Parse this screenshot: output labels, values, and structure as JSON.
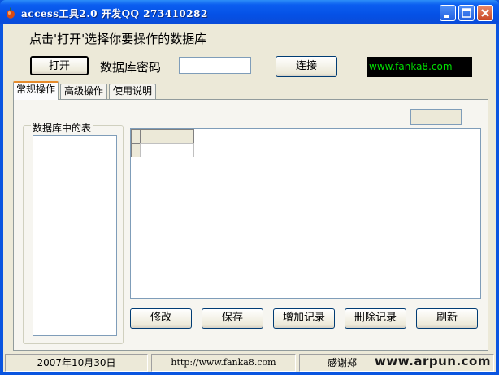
{
  "window": {
    "title": "access工具2.0 开发QQ 273410282"
  },
  "header": {
    "instruction": "点击'打开'选择你要操作的数据库",
    "open_button": "打开",
    "password_label": "数据库密码",
    "password_value": "",
    "connect_button": "连接",
    "site_badge": "www.fanka8.com"
  },
  "tabs": [
    {
      "label": "常规操作",
      "active": true
    },
    {
      "label": "高级操作",
      "active": false
    },
    {
      "label": "使用说明",
      "active": false
    }
  ],
  "tables_panel": {
    "title": "数据库中的表"
  },
  "actions": {
    "modify": "修改",
    "save": "保存",
    "add": "增加记录",
    "delete": "删除记录",
    "refresh": "刷新"
  },
  "statusbar": {
    "date": "2007年10月30日",
    "url": "http://www.fanka8.com",
    "thanks": "感谢郑"
  },
  "watermark": "www.arpun.com",
  "colors": {
    "titlebar": "#0551e6",
    "badge_bg": "#000000",
    "badge_text": "#00e000",
    "active_tab": "#e68b2c"
  }
}
